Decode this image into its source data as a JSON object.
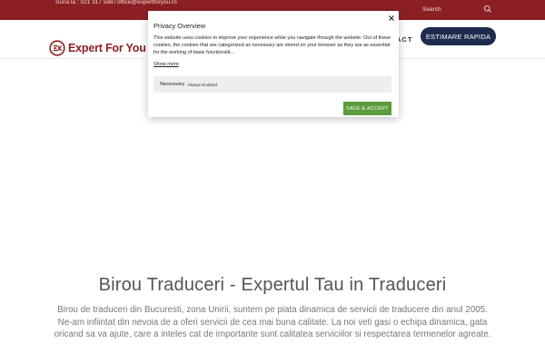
{
  "topbar": {
    "phone": "Suna la : 021 317 5887",
    "email": "office@expertforyou.ro",
    "search_placeholder": "Search",
    "search_icon": "magnifier-icon"
  },
  "header": {
    "logo_text": "Expert For You",
    "nav_contact": "ACT",
    "cta_label": "ESTIMARE RAPIDA"
  },
  "hero": {
    "title": "Birou Traduceri - Expertul Tau in Traduceri",
    "description": "Birou de traduceri din Bucuresti, zona Unirii, suntem pe piata dinamica de servicii de traducere din anul 2005. Ne-am infiintat din nevoia de a oferi servicii de cea mai buna calitate. La noi veti gasi o echipa dinamica, gata oricand sa va ajute, care a inteles cat de importante sunt calitatea serviciilor si respectarea termenelor agreate."
  },
  "cookie_modal": {
    "title": "Privacy Overview",
    "text": "This website uses cookies to improve your experience while you navigate through the website. Out of these cookies, the cookies that are categorized as necessary are stored on your browser as they are as essential for the working of basic functionalit...",
    "show_more": "Show more",
    "necessary_label": "Necessary",
    "necessary_status": "Always Enabled",
    "save_button": "SAVE & ACCEPT"
  },
  "colors": {
    "brand_red": "#8b1f23",
    "cta_navy": "#1d2c4e",
    "accept_green": "#5c9c3c"
  }
}
